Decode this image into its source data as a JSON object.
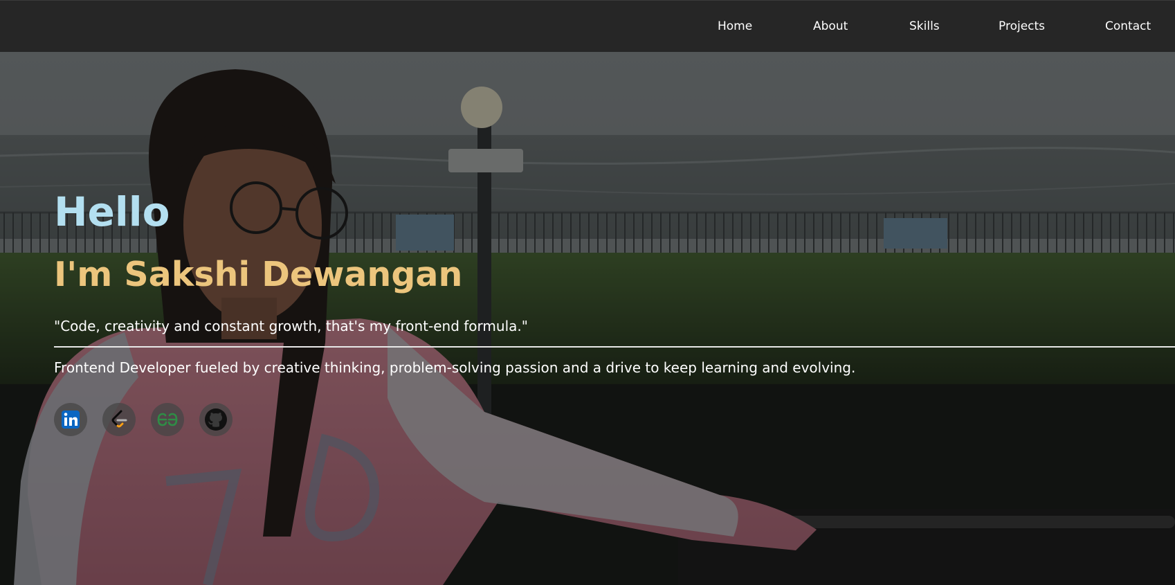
{
  "nav": {
    "items": [
      {
        "label": "Home"
      },
      {
        "label": "About"
      },
      {
        "label": "Skills"
      },
      {
        "label": "Projects"
      },
      {
        "label": "Contact"
      }
    ]
  },
  "hero": {
    "greeting": "Hello",
    "name": "I'm Sakshi Dewangan",
    "quote": "\"Code, creativity and constant growth, that's my front-end formula.\"",
    "description": "Frontend Developer fueled by creative thinking, problem-solving passion and a drive to keep learning and evolving."
  },
  "social_links": [
    {
      "icon": "linkedin-icon",
      "color": "#0a66c2"
    },
    {
      "icon": "leetcode-icon",
      "color": "#ffa116"
    },
    {
      "icon": "geeksforgeeks-icon",
      "color": "#2f8d46"
    },
    {
      "icon": "github-icon",
      "color": "#111111"
    }
  ],
  "colors": {
    "navbar": "#262626",
    "greeting": "#b3dff0",
    "name": "#ecc57d",
    "text": "#ffffff"
  }
}
